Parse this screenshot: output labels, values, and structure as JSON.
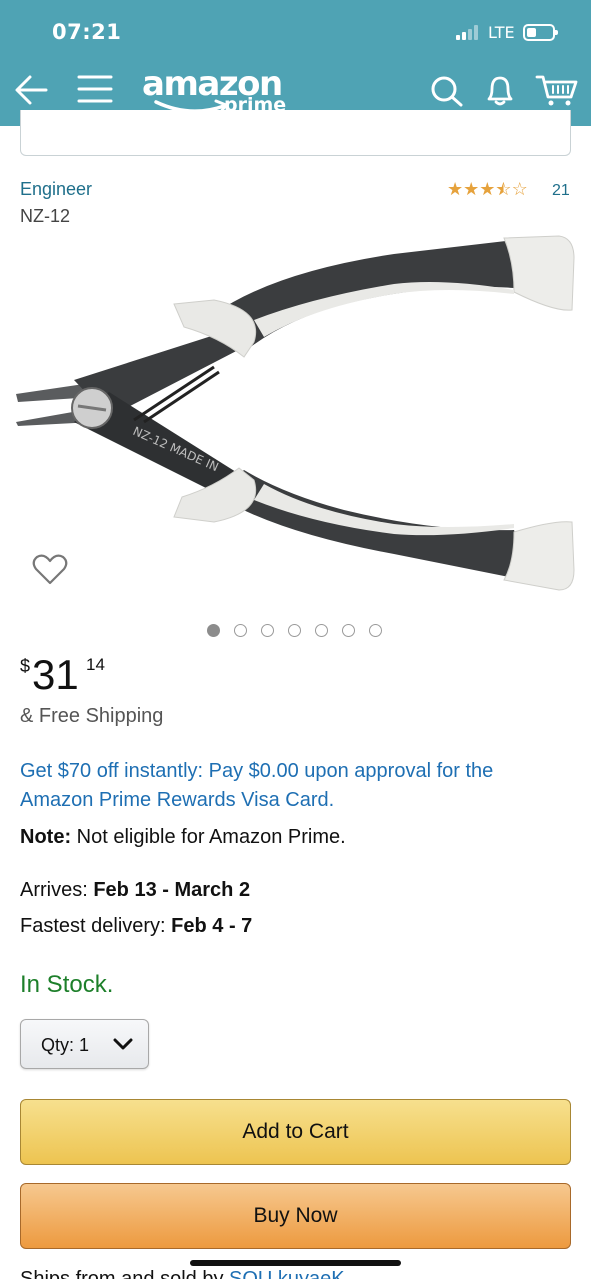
{
  "status_bar": {
    "time": "07:21",
    "network": "LTE"
  },
  "header": {
    "logo_text": "amazon",
    "logo_sub": "prime",
    "icons": [
      "back-arrow-icon",
      "menu-icon",
      "search-icon",
      "bell-icon",
      "cart-icon"
    ]
  },
  "product": {
    "brand": "Engineer",
    "model": "NZ-12",
    "rating_stars": 3.5,
    "rating_count": "21",
    "image_dots_total": 7,
    "image_dots_active": 1
  },
  "price": {
    "currency": "$",
    "whole": "31",
    "fraction": "14",
    "shipping": "& Free Shipping"
  },
  "promo": "Get $70 off instantly: Pay $0.00 upon approval for the Amazon Prime Rewards Visa Card.",
  "note": {
    "label": "Note:",
    "text": " Not eligible for Amazon Prime."
  },
  "delivery": {
    "arrives_label": "Arrives: ",
    "arrives_value": "Feb 13 - March 2",
    "fastest_label": "Fastest delivery: ",
    "fastest_value": "Feb 4 - 7"
  },
  "stock": "In Stock.",
  "quantity": {
    "label": "Qty:",
    "value": "1"
  },
  "buttons": {
    "add_to_cart": "Add to Cart",
    "buy_now": "Buy Now"
  },
  "sold_by": {
    "prefix": "Ships from and sold by ",
    "seller": "SOU kuyaeK"
  },
  "colors": {
    "header": "#4fa3b4",
    "link": "#1e6fb3",
    "in_stock": "#1d7f2a",
    "cart_button": "#f0cf6b",
    "buy_button": "#f0aa55"
  }
}
